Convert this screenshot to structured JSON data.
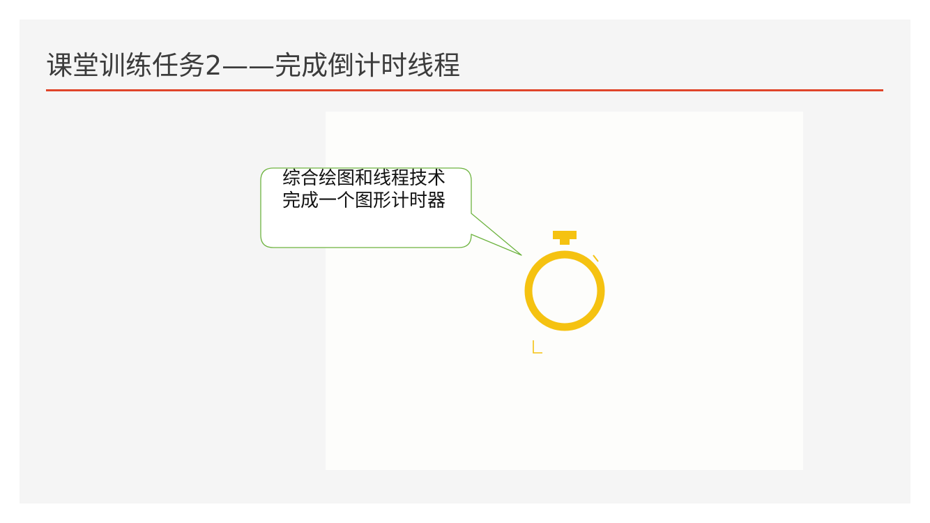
{
  "slide": {
    "title": "课堂训练任务2——完成倒计时线程"
  },
  "callout": {
    "line1": "综合绘图和线程技术",
    "line2": "完成一个图形计时器"
  },
  "colors": {
    "title_underline": "#e0452a",
    "callout_border": "#6db33f",
    "timer": "#f5c211",
    "panel": "#fdfdfb",
    "slide_bg": "#f5f5f5"
  },
  "icons": {
    "timer": "stopwatch-icon"
  }
}
